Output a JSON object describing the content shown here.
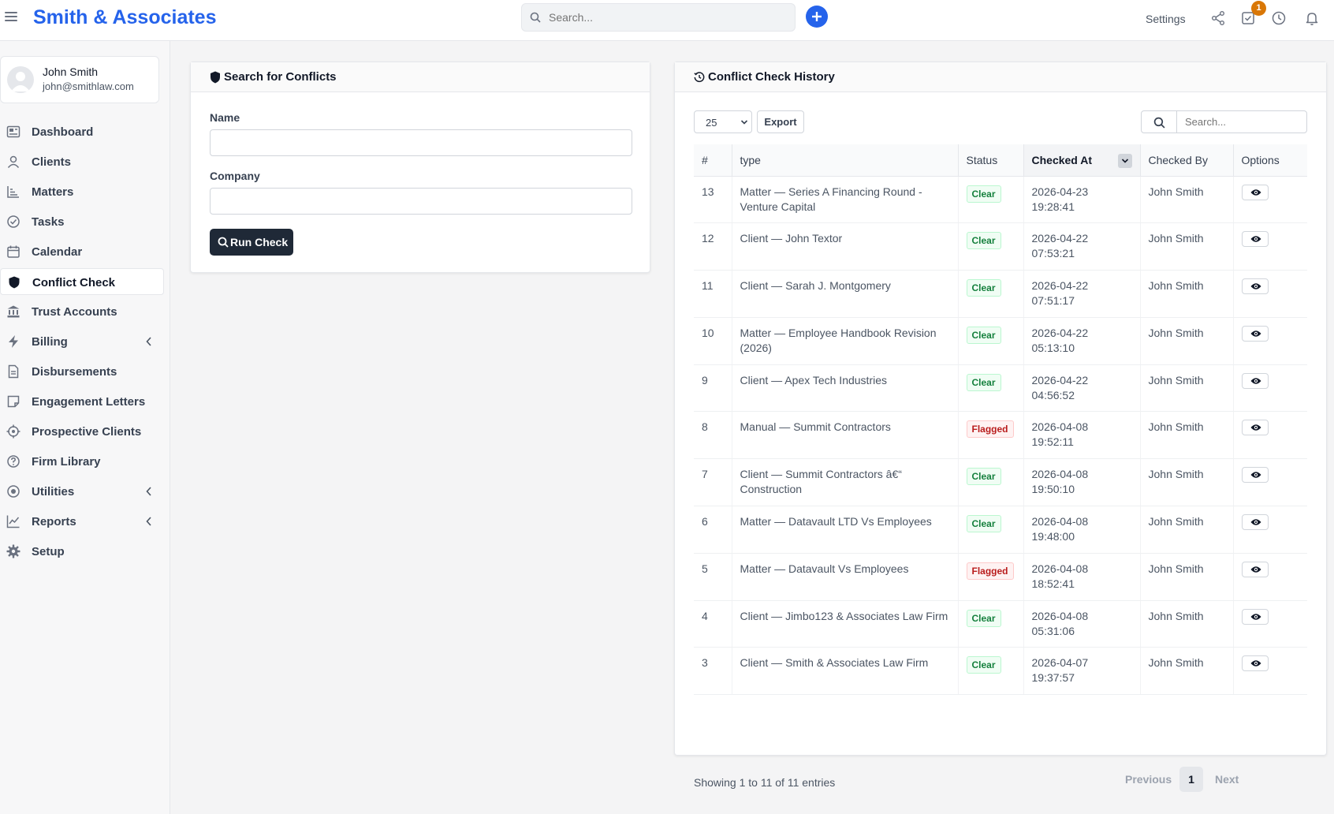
{
  "header": {
    "brand": "Smith & Associates",
    "search_placeholder": "Search...",
    "settings_label": "Settings",
    "tasks_badge": "1",
    "icons": [
      "menu-icon",
      "search-icon",
      "plus-icon",
      "share-icon",
      "tasks-icon",
      "history-icon",
      "bell-icon"
    ]
  },
  "user": {
    "name": "John Smith",
    "email": "john@smithlaw.com"
  },
  "sidebar": {
    "items": [
      {
        "label": "Dashboard",
        "icon": "dashboard-icon"
      },
      {
        "label": "Clients",
        "icon": "user-icon"
      },
      {
        "label": "Matters",
        "icon": "chart-icon"
      },
      {
        "label": "Tasks",
        "icon": "check-circle-icon"
      },
      {
        "label": "Calendar",
        "icon": "calendar-icon"
      },
      {
        "label": "Conflict Check",
        "icon": "shield-icon",
        "active": true
      },
      {
        "label": "Trust Accounts",
        "icon": "bank-icon"
      },
      {
        "label": "Billing",
        "icon": "bolt-icon",
        "expandable": true
      },
      {
        "label": "Disbursements",
        "icon": "document-icon"
      },
      {
        "label": "Engagement Letters",
        "icon": "note-icon"
      },
      {
        "label": "Prospective Clients",
        "icon": "crosshair-icon"
      },
      {
        "label": "Firm Library",
        "icon": "help-circle-icon"
      },
      {
        "label": "Utilities",
        "icon": "target-icon",
        "expandable": true
      },
      {
        "label": "Reports",
        "icon": "line-chart-icon",
        "expandable": true
      },
      {
        "label": "Setup",
        "icon": "gear-icon"
      }
    ]
  },
  "search_panel": {
    "title": "Search for Conflicts",
    "name_label": "Name",
    "name_value": "",
    "company_label": "Company",
    "company_value": "",
    "run_button": "Run Check"
  },
  "history_panel": {
    "title": "Conflict Check History",
    "page_size": "25",
    "export_label": "Export",
    "search_placeholder": "Search...",
    "columns": [
      "#",
      "type",
      "Status",
      "Checked At",
      "Checked By",
      "Options"
    ],
    "sorted_column": "Checked At",
    "rows": [
      {
        "id": "13",
        "type": "Matter — Series A Financing Round - Venture Capital",
        "status": "Clear",
        "date": "2026-04-23",
        "time": "19:28:41",
        "by": "John Smith"
      },
      {
        "id": "12",
        "type": "Client — John Textor",
        "status": "Clear",
        "date": "2026-04-22",
        "time": "07:53:21",
        "by": "John Smith"
      },
      {
        "id": "11",
        "type": "Client — Sarah J. Montgomery",
        "status": "Clear",
        "date": "2026-04-22",
        "time": "07:51:17",
        "by": "John Smith"
      },
      {
        "id": "10",
        "type": "Matter — Employee Handbook Revision (2026)",
        "status": "Clear",
        "date": "2026-04-22",
        "time": "05:13:10",
        "by": "John Smith"
      },
      {
        "id": "9",
        "type": "Client — Apex Tech Industries",
        "status": "Clear",
        "date": "2026-04-22",
        "time": "04:56:52",
        "by": "John Smith"
      },
      {
        "id": "8",
        "type": "Manual — Summit Contractors",
        "status": "Flagged",
        "date": "2026-04-08",
        "time": "19:52:11",
        "by": "John Smith"
      },
      {
        "id": "7",
        "type": "Client — Summit Contractors â€“ Construction",
        "status": "Clear",
        "date": "2026-04-08",
        "time": "19:50:10",
        "by": "John Smith"
      },
      {
        "id": "6",
        "type": "Matter — Datavault LTD Vs Employees",
        "status": "Clear",
        "date": "2026-04-08",
        "time": "19:48:00",
        "by": "John Smith"
      },
      {
        "id": "5",
        "type": "Matter — Datavault Vs Employees",
        "status": "Flagged",
        "date": "2026-04-08",
        "time": "18:52:41",
        "by": "John Smith"
      },
      {
        "id": "4",
        "type": "Client — Jimbo123 & Associates Law Firm",
        "status": "Clear",
        "date": "2026-04-08",
        "time": "05:31:06",
        "by": "John Smith"
      },
      {
        "id": "3",
        "type": "Client — Smith & Associates Law Firm",
        "status": "Clear",
        "date": "2026-04-07",
        "time": "19:37:57",
        "by": "John Smith"
      }
    ],
    "info_text": "Showing 1 to 11 of 11 entries",
    "pagination": {
      "previous": "Previous",
      "current": "1",
      "next": "Next"
    }
  },
  "colors": {
    "brand": "#2563eb",
    "clear": "#15803d",
    "flagged": "#b91c1c",
    "badge": "#d97706",
    "dark_button": "#1f2937"
  }
}
